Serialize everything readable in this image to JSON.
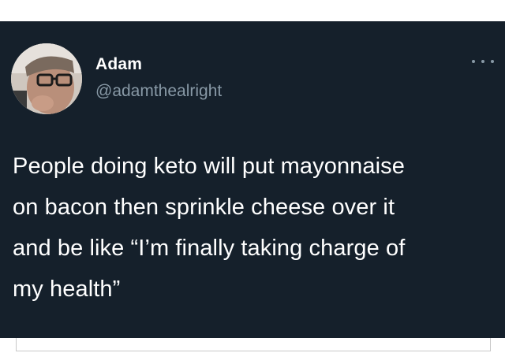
{
  "tweet": {
    "author_name": "Adam",
    "author_handle": "@adamthealright",
    "text": "People doing keto will put mayonnaise\non bacon then sprinkle cheese over it\nand be like “I’m finally taking charge of\nmy health”"
  },
  "icons": {
    "avatar": "avatar-photo",
    "more": "more-options-icon"
  },
  "colors": {
    "card_background": "#15202b",
    "primary_text": "#ffffff",
    "secondary_text": "#8899a6"
  }
}
